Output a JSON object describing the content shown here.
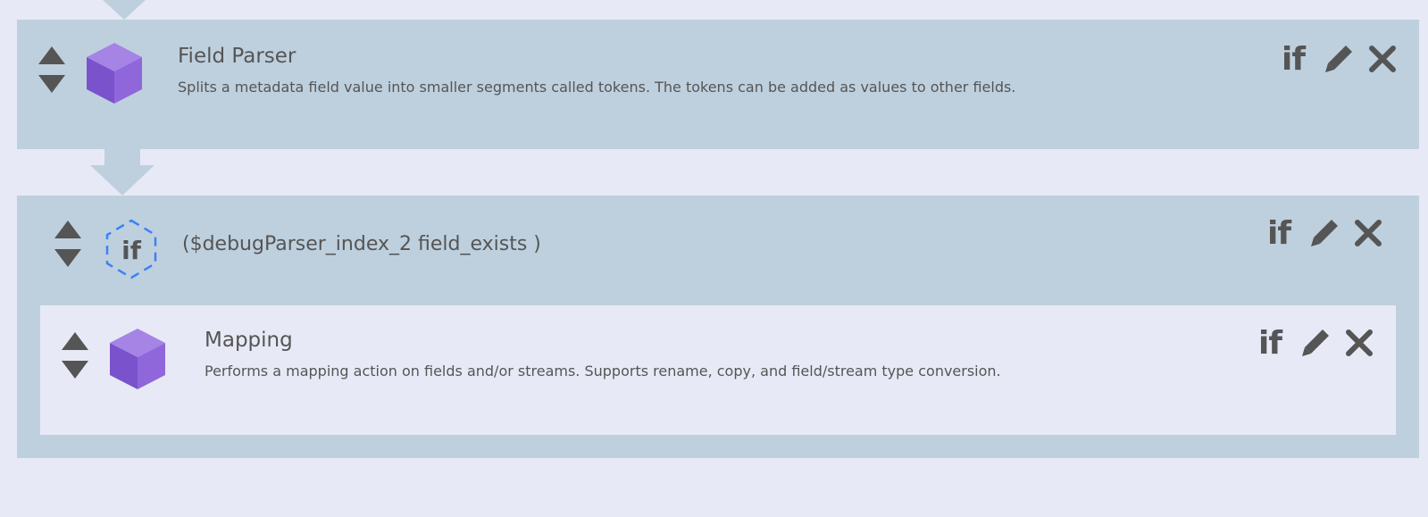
{
  "steps": {
    "field_parser": {
      "title": "Field Parser",
      "description": "Splits a metadata field value into smaller segments called tokens. The tokens can be added as values to other fields.",
      "icon": "cube-icon"
    },
    "condition": {
      "badge": "if",
      "expression": "($debugParser_index_2 field_exists )",
      "icon": "if-condition-icon"
    },
    "mapping": {
      "title": "Mapping",
      "description": "Performs a mapping action on fields and/or streams. Supports rename, copy, and field/stream type conversion.",
      "icon": "cube-icon"
    }
  },
  "actions": {
    "condition_label": "if",
    "edit_icon": "pencil-icon",
    "delete_icon": "close-icon"
  },
  "colors": {
    "page_background": "#e7eaf6",
    "step_background": "#bed0de",
    "cube": "#8a63d2",
    "condition_hex": "#3b82f6",
    "icon_gray": "#555555"
  }
}
